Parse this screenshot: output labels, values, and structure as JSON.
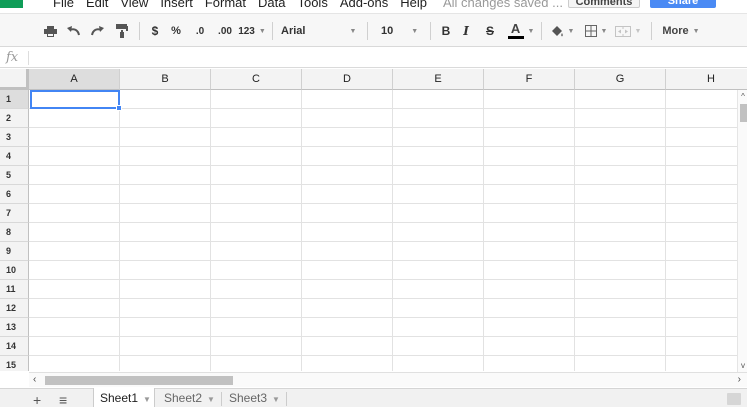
{
  "menu": {
    "items": [
      "File",
      "Edit",
      "View",
      "Insert",
      "Format",
      "Data",
      "Tools",
      "Add-ons",
      "Help"
    ],
    "status": "All changes saved ...",
    "comments_label": "Comments",
    "share_label": "Share"
  },
  "toolbar": {
    "currency": "$",
    "percent": "%",
    "decrease_decimal": ".0",
    "increase_decimal": ".00",
    "more_formats": "123",
    "font": "Arial",
    "font_size": "10",
    "bold": "B",
    "italic": "I",
    "strike": "S",
    "text_color": "A",
    "more": "More"
  },
  "formula_bar": {
    "label": "fx",
    "value": ""
  },
  "grid": {
    "columns": [
      "A",
      "B",
      "C",
      "D",
      "E",
      "F",
      "G",
      "H"
    ],
    "rows": [
      "1",
      "2",
      "3",
      "4",
      "5",
      "6",
      "7",
      "8",
      "9",
      "10",
      "11",
      "12",
      "13",
      "14",
      "15"
    ],
    "selected_cell": "A1"
  },
  "sheets": {
    "tabs": [
      {
        "label": "Sheet1",
        "active": true
      },
      {
        "label": "Sheet2",
        "active": false
      },
      {
        "label": "Sheet3",
        "active": false
      }
    ],
    "add_label": "+",
    "list_label": "≡"
  },
  "colors": {
    "accent": "#4285f4",
    "share": "#4a8af4",
    "brand": "#0f9d58"
  }
}
